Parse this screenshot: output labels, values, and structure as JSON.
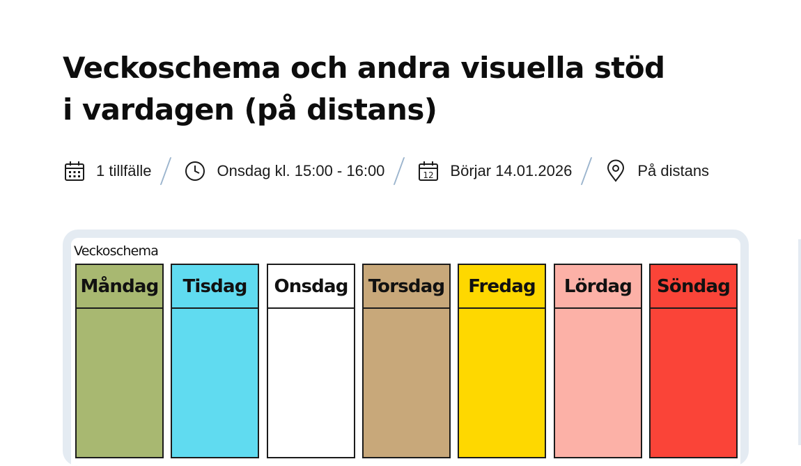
{
  "page": {
    "title": "Veckoschema och andra visuella stöd i vardagen (på distans)"
  },
  "meta": {
    "sessions": {
      "icon": "calendar-grid-icon",
      "text": "1 tillfälle"
    },
    "time": {
      "icon": "clock-icon",
      "text": "Onsdag kl. 15:00 - 16:00"
    },
    "start": {
      "icon": "calendar-12-icon",
      "text": "Börjar 14.01.2026",
      "icon_number": "12"
    },
    "location": {
      "icon": "map-pin-icon",
      "text": "På distans"
    }
  },
  "image": {
    "heading": "Veckoschema",
    "days": [
      {
        "label": "Måndag",
        "color": "#a8b871"
      },
      {
        "label": "Tisdag",
        "color": "#60dbf0"
      },
      {
        "label": "Onsdag",
        "color": "#ffffff"
      },
      {
        "label": "Torsdag",
        "color": "#c8a87a"
      },
      {
        "label": "Fredag",
        "color": "#fed800"
      },
      {
        "label": "Lördag",
        "color": "#fcb1a7"
      },
      {
        "label": "Söndag",
        "color": "#fa4438"
      }
    ]
  },
  "colors": {
    "separator": "#9bb4cd",
    "card_frame": "#e4ebf2"
  }
}
